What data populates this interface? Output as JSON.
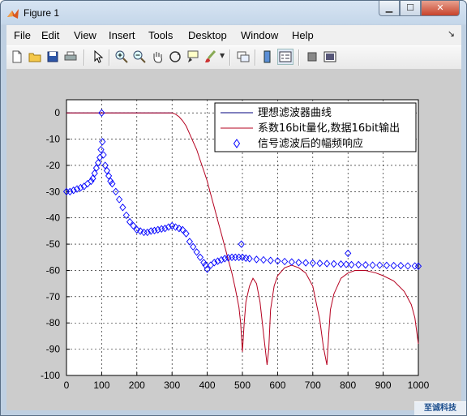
{
  "window": {
    "title": "Figure 1",
    "minimize_glyph": "▁",
    "maximize_glyph": "☐",
    "close_glyph": "✕"
  },
  "menu": [
    "File",
    "Edit",
    "View",
    "Insert",
    "Tools",
    "Desktop",
    "Window",
    "Help"
  ],
  "menu_dock_glyph": "↘",
  "toolbar": [
    "new-figure-icon",
    "open-file-icon",
    "save-icon",
    "print-icon",
    "pointer-icon",
    "zoom-in-icon",
    "zoom-out-icon",
    "pan-icon",
    "rotate-3d-icon",
    "data-cursor-icon",
    "brush-icon",
    "link-plot-icon",
    "colorbar-icon",
    "legend-icon",
    "hide-plot-tools-icon",
    "show-plot-tools-icon"
  ],
  "watermark": "至诚科技",
  "chart_data": {
    "type": "line",
    "title": "",
    "xlabel": "",
    "ylabel": "",
    "xlim": [
      0,
      1000
    ],
    "ylim": [
      -100,
      5
    ],
    "xticks": [
      0,
      100,
      200,
      300,
      400,
      500,
      600,
      700,
      800,
      900,
      1000
    ],
    "yticks": [
      0,
      -10,
      -20,
      -30,
      -40,
      -50,
      -60,
      -70,
      -80,
      -90,
      -100
    ],
    "grid": true,
    "legend_position": "top-right",
    "series": [
      {
        "name": "理想滤波器曲线",
        "color": "#00007f",
        "style": "line",
        "x": [
          0,
          300,
          400,
          500,
          600,
          700,
          800,
          900,
          1000
        ],
        "y": [
          0,
          0,
          null,
          null,
          null,
          null,
          null,
          null,
          null
        ]
      },
      {
        "name": "系数16bit量化,数据16bit输出",
        "color": "#b5001f",
        "style": "line",
        "x": [
          0,
          300,
          310,
          320,
          330,
          340,
          350,
          360,
          370,
          380,
          390,
          400,
          410,
          420,
          430,
          440,
          450,
          460,
          470,
          480,
          490,
          495,
          500,
          505,
          510,
          520,
          530,
          540,
          550,
          560,
          570,
          575,
          580,
          590,
          600,
          620,
          640,
          660,
          680,
          700,
          720,
          730,
          740,
          745,
          750,
          760,
          780,
          800,
          820,
          850,
          880,
          900,
          930,
          960,
          980,
          990,
          1000
        ],
        "y": [
          0,
          0,
          -0.5,
          -1.5,
          -3,
          -5,
          -8,
          -11,
          -14,
          -18,
          -22,
          -26,
          -31,
          -36,
          -41,
          -46,
          -51,
          -56,
          -61,
          -67,
          -74,
          -80,
          -91,
          -80,
          -72,
          -66,
          -63,
          -65,
          -72,
          -84,
          -96,
          -90,
          -75,
          -66,
          -62,
          -59,
          -58,
          -59,
          -61,
          -66,
          -79,
          -89,
          -96,
          -85,
          -75,
          -69,
          -63,
          -61,
          -60,
          -60,
          -61,
          -62,
          -64,
          -68,
          -73,
          -78,
          -88
        ]
      },
      {
        "name": "信号滤波后的幅频响应",
        "color": "#0000ff",
        "style": "diamond",
        "x": [
          0,
          10,
          20,
          30,
          40,
          50,
          60,
          70,
          75,
          80,
          85,
          90,
          95,
          98,
          100,
          102,
          105,
          110,
          115,
          120,
          125,
          130,
          140,
          150,
          160,
          170,
          180,
          190,
          200,
          210,
          220,
          230,
          240,
          250,
          260,
          270,
          280,
          290,
          300,
          310,
          320,
          330,
          340,
          350,
          360,
          370,
          380,
          390,
          395,
          400,
          410,
          420,
          430,
          440,
          450,
          460,
          470,
          480,
          490,
          497,
          500,
          510,
          520,
          540,
          560,
          580,
          600,
          620,
          640,
          660,
          680,
          700,
          720,
          740,
          760,
          780,
          795,
          800,
          810,
          830,
          850,
          870,
          890,
          910,
          930,
          950,
          970,
          990,
          1000
        ],
        "y": [
          -30,
          -30,
          -29.5,
          -29,
          -28.5,
          -28,
          -27,
          -26,
          -25,
          -23,
          -21,
          -19,
          -17,
          -14,
          0,
          -11,
          -16,
          -20,
          -22,
          -24,
          -26,
          -27,
          -30,
          -33,
          -36,
          -39,
          -41.5,
          -43,
          -44.5,
          -45,
          -45.5,
          -45.5,
          -45,
          -44.8,
          -44.5,
          -44.2,
          -44,
          -43.5,
          -43,
          -43.5,
          -44,
          -44.5,
          -46,
          -49,
          -51,
          -53,
          -55,
          -57,
          -58,
          -59.5,
          -58,
          -57,
          -56.5,
          -56,
          -55.5,
          -55.2,
          -55,
          -55,
          -55,
          -50,
          -55,
          -55.3,
          -55.5,
          -55.8,
          -56,
          -56.2,
          -56.4,
          -56.6,
          -56.8,
          -57,
          -57.1,
          -57.2,
          -57.3,
          -57.4,
          -57.5,
          -57.6,
          -57.7,
          -53.5,
          -57.8,
          -57.8,
          -57.9,
          -58,
          -58,
          -58.1,
          -58.2,
          -58.2,
          -58.3,
          -58.3,
          -58.4
        ]
      }
    ]
  }
}
